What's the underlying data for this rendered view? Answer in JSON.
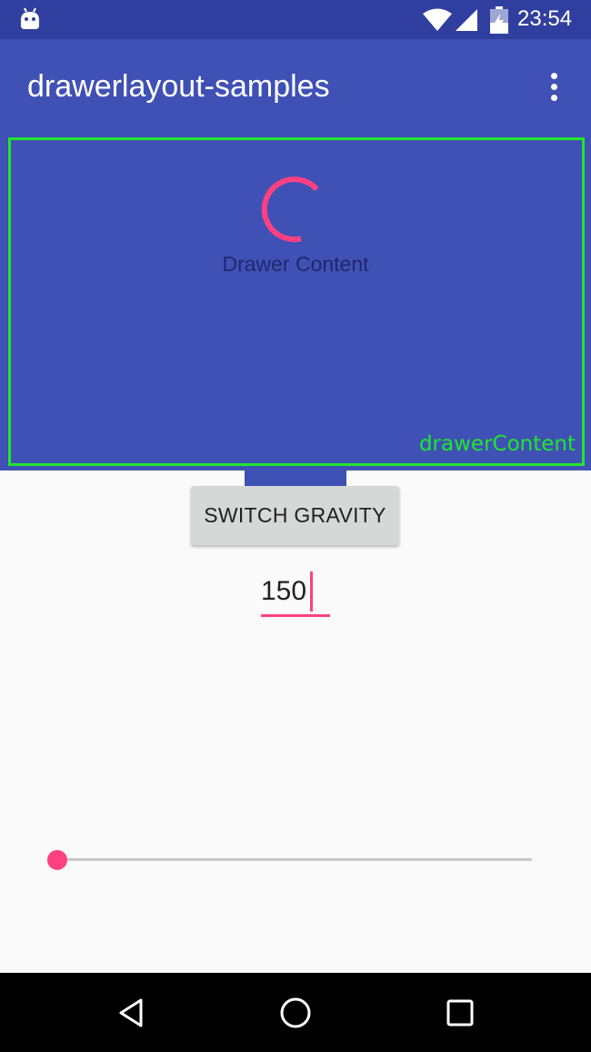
{
  "status_bar": {
    "time": "23:54",
    "icons": [
      "android-icon",
      "wifi-icon",
      "signal-icon",
      "battery-icon"
    ]
  },
  "app_bar": {
    "title": "drawerlayout-samples",
    "overflow_icon": "more-vert-icon"
  },
  "drawer": {
    "content_label": "Drawer Content",
    "debug_label": "drawerContent",
    "debug_color": "#1ee82a",
    "background_color": "#3f51b5",
    "spinner_color": "#ff4081"
  },
  "main": {
    "switch_button_label": "SWITCH GRAVITY",
    "value_input": "150",
    "slider_fraction": 0.0
  },
  "nav_bar": {
    "icons": [
      "back-icon",
      "home-icon",
      "recents-icon"
    ]
  },
  "colors": {
    "primary": "#3f51b5",
    "primary_dark": "#303f9f",
    "accent": "#ff4081"
  }
}
